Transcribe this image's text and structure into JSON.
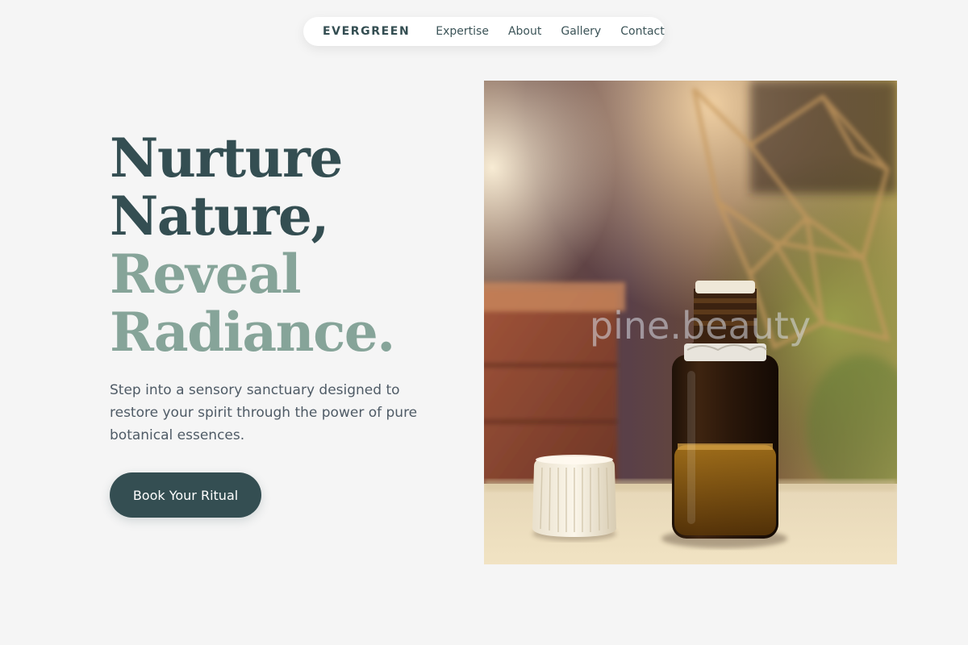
{
  "nav": {
    "brand": "EVERGREEN",
    "links": [
      "Expertise",
      "About",
      "Gallery",
      "Contact"
    ]
  },
  "hero": {
    "headline": {
      "line1": "Nurture",
      "line2": "Nature,",
      "line3": "Reveal",
      "line4": "Radiance."
    },
    "description": "Step into a sensory sanctuary designed to restore your spirit through the power of pure botanical essences.",
    "cta_label": "Book Your Ritual"
  },
  "image": {
    "watermark": "pine.beauty",
    "subject": "amber-essential-oil-bottle"
  },
  "colors": {
    "background": "#f5f5f5",
    "primary": "#344e52",
    "accent": "#86a499",
    "body_text": "#4f5b66",
    "nav_bg": "#ffffff"
  }
}
